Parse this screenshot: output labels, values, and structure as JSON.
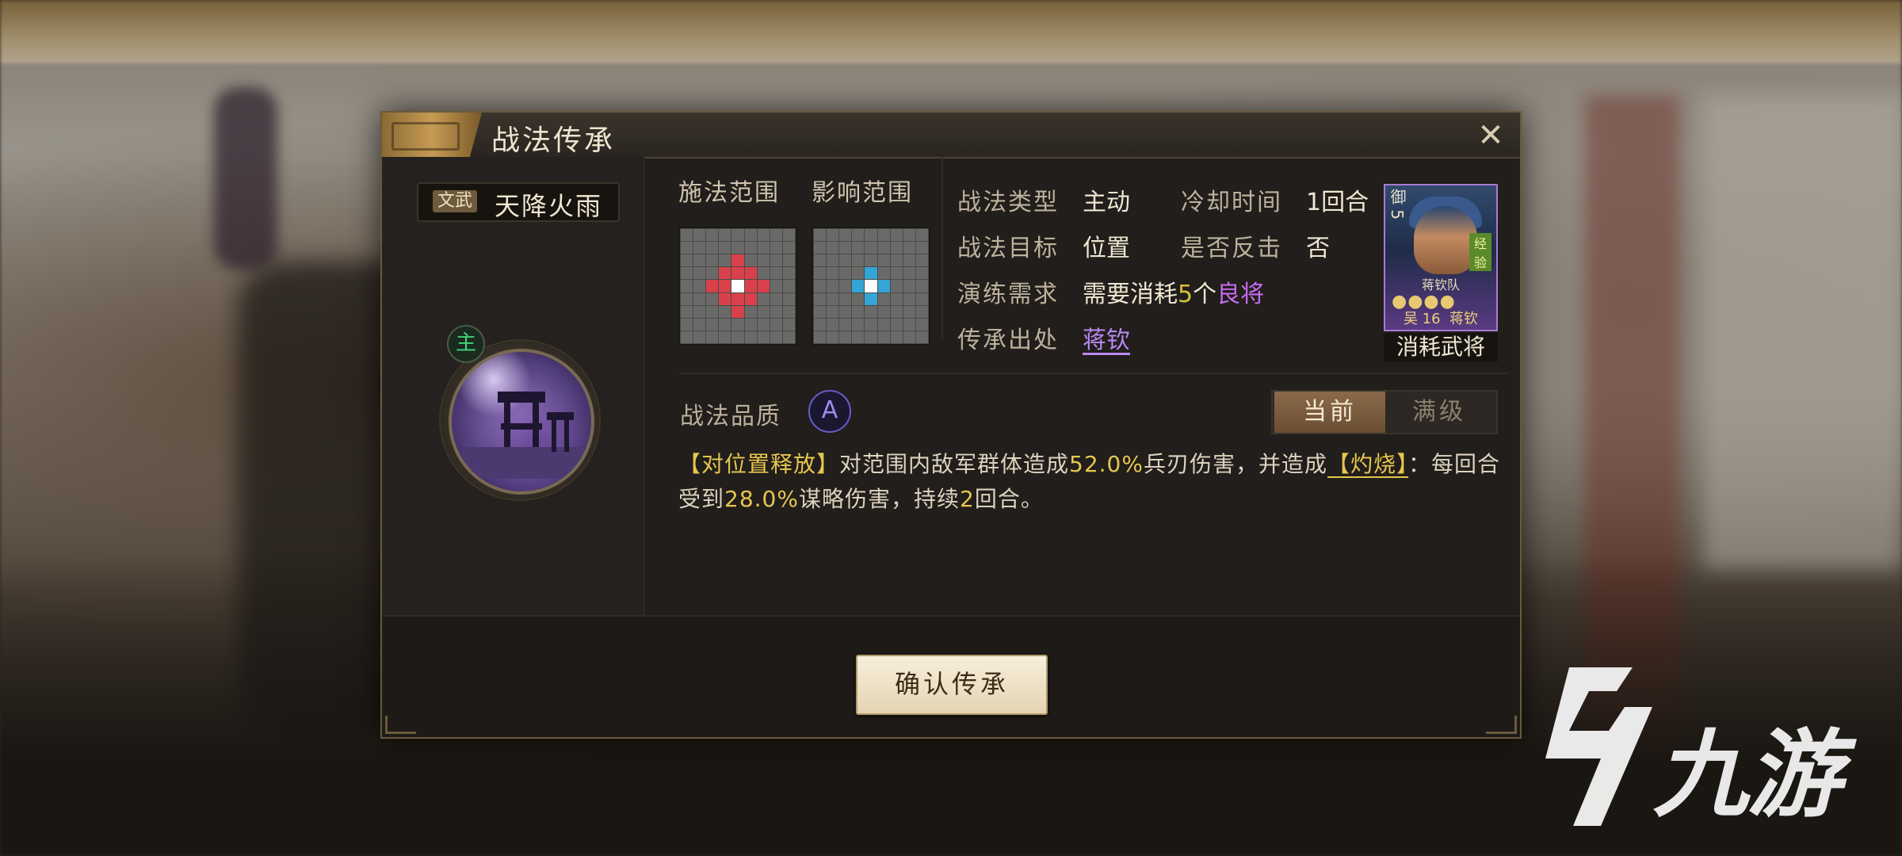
{
  "dialog": {
    "title": "战法传承",
    "close_icon": "close-icon"
  },
  "skill": {
    "tag": "文武",
    "name": "天降火雨",
    "main_badge": "主",
    "image_icon": "fire-rain-tower-icon"
  },
  "ranges": {
    "cast_label": "施法范围",
    "effect_label": "影响范围",
    "cast_color": "#d9414a",
    "effect_color": "#34a5d6"
  },
  "info": {
    "type_label": "战法类型",
    "type_value": "主动",
    "cooldown_label": "冷却时间",
    "cooldown_value": "1回合",
    "target_label": "战法目标",
    "target_value": "位置",
    "counter_label": "是否反击",
    "counter_value": "否",
    "train_label": "演练需求",
    "train_prefix": "需要消耗",
    "train_count": "5",
    "train_unit": "个",
    "train_item": "良将",
    "origin_label": "传承出处",
    "origin_value": "蒋钦"
  },
  "hero_card": {
    "corner": "御 5",
    "team": "蒋钦队",
    "stars": "●●●●",
    "faction_level": "吴 16",
    "name": "蒋钦",
    "badge": "经验",
    "caption": "消耗武将"
  },
  "quality": {
    "label": "战法品质",
    "grade": "A",
    "grade_color": "#a08af2"
  },
  "toggle": {
    "current": "当前",
    "max": "满级",
    "selected": "当前"
  },
  "description": {
    "release": "【对位置释放】",
    "part1": "对范围内敌军群体造成",
    "damage_pct": "52.0%",
    "part2": "兵刃伤害，并造成",
    "status": "【灼烧】",
    "part3": "：每回合受到",
    "burn_pct": "28.0%",
    "part4": "谋略伤害，持续",
    "turns": "2",
    "part5": "回合。"
  },
  "buttons": {
    "confirm": "确认传承"
  },
  "watermark": {
    "text": "九游",
    "logo_icon": "jiuyou-logo-icon"
  }
}
